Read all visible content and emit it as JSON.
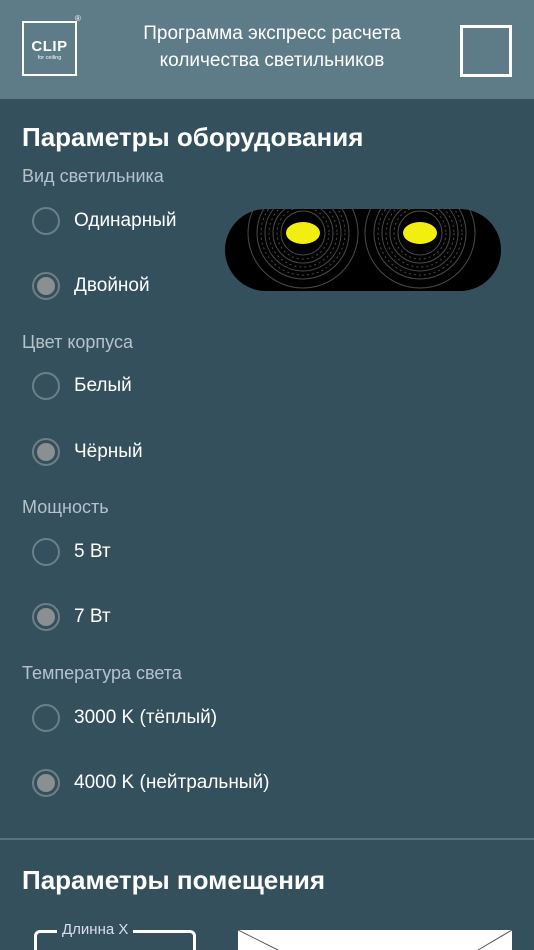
{
  "header": {
    "logo_text": "CLIP",
    "logo_subtext": "for ceiling",
    "logo_registered": "®",
    "title_line1": "Программа экспресс расчета",
    "title_line2": "количества светильников",
    "menu_icon": "square-menu-icon"
  },
  "equipment": {
    "section_title": "Параметры оборудования",
    "lamp_type": {
      "label": "Вид светильника",
      "options": [
        {
          "label": "Одинарный",
          "selected": false
        },
        {
          "label": "Двойной",
          "selected": true
        }
      ],
      "preview_icon": "double-lamp-icon"
    },
    "body_color": {
      "label": "Цвет корпуса",
      "options": [
        {
          "label": "Белый",
          "selected": false
        },
        {
          "label": "Чёрный",
          "selected": true
        }
      ]
    },
    "power": {
      "label": "Мощность",
      "options": [
        {
          "label": "5 Вт",
          "selected": false
        },
        {
          "label": "7 Вт",
          "selected": true
        }
      ]
    },
    "temperature": {
      "label": "Температура света",
      "options": [
        {
          "label": "3000 K (тёплый)",
          "selected": false
        },
        {
          "label": "4000 K (нейтральный)",
          "selected": true
        }
      ]
    }
  },
  "room": {
    "section_title": "Параметры помещения",
    "length_x_label": "Длинна X",
    "length_x_value": ""
  },
  "colors": {
    "background": "#34505c",
    "header": "#5e7b88",
    "lamp_body": "#000000",
    "lamp_light": "#f2ee0f"
  }
}
